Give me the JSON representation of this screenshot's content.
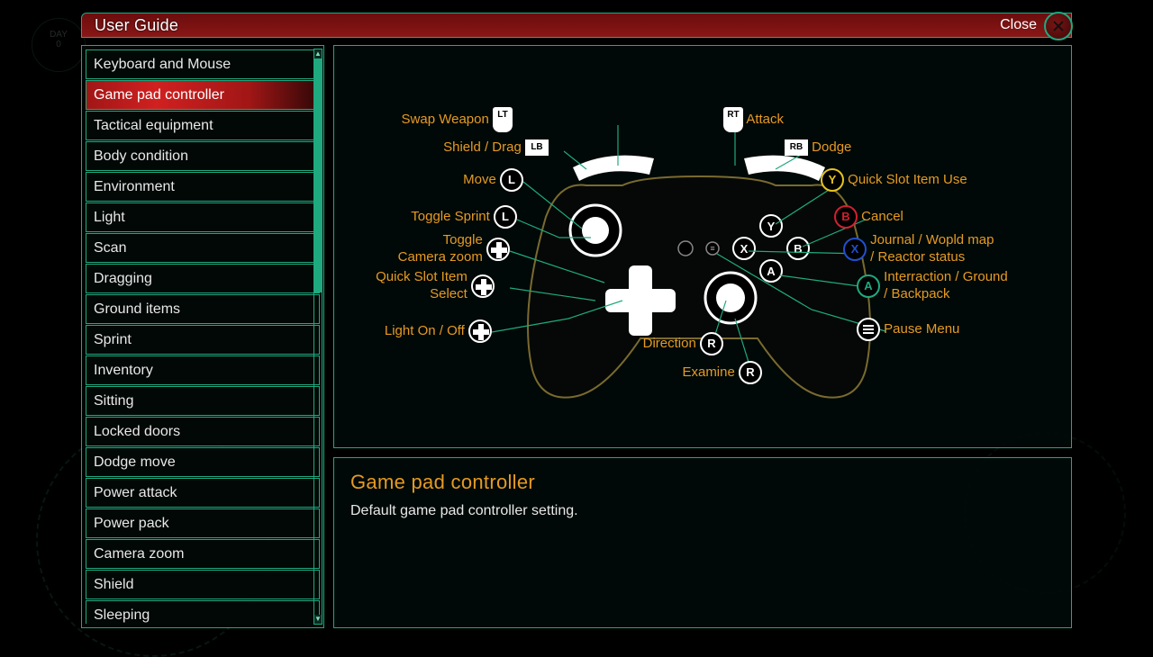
{
  "window": {
    "title": "User Guide",
    "close_label": "Close"
  },
  "bg": {
    "day_label": "DAY",
    "day_value": "0"
  },
  "sidebar": {
    "items": [
      "Keyboard and Mouse",
      "Game pad controller",
      "Tactical equipment",
      "Body condition",
      "Environment",
      "Light",
      "Scan",
      "Dragging",
      "Ground items",
      "Sprint",
      "Inventory",
      "Sitting",
      "Locked doors",
      "Dodge move",
      "Power attack",
      "Power pack",
      "Camera zoom",
      "Shield",
      "Sleeping"
    ],
    "selected_index": 1
  },
  "description": {
    "title": "Game pad controller",
    "text": "Default game pad controller setting."
  },
  "controller": {
    "left": {
      "swap_weapon": {
        "label": "Swap Weapon",
        "btn": "LT"
      },
      "shield_drag": {
        "label": "Shield / Drag",
        "btn": "LB"
      },
      "move": {
        "label": "Move",
        "btn": "L"
      },
      "toggle_sprint": {
        "label": "Toggle Sprint",
        "btn": "L"
      },
      "camera_zoom": {
        "label": "Toggle\nCamera zoom",
        "btn": ""
      },
      "quick_slot_sel": {
        "label": "Quick Slot Item\nSelect",
        "btn": ""
      },
      "light": {
        "label": "Light On / Off",
        "btn": ""
      }
    },
    "right": {
      "attack": {
        "label": "Attack",
        "btn": "RT"
      },
      "dodge": {
        "label": "Dodge",
        "btn": "RB"
      },
      "quick_use": {
        "label": "Quick Slot Item Use",
        "btn": "Y"
      },
      "cancel": {
        "label": "Cancel",
        "btn": "B"
      },
      "journal": {
        "label": "Journal / Wopld map\n/ Reactor status",
        "btn": "X"
      },
      "interact": {
        "label": "Interraction / Ground\n/ Backpack",
        "btn": "A"
      },
      "pause": {
        "label": "Pause Menu",
        "btn": "≡"
      }
    },
    "bottom": {
      "direction": {
        "label": "Direction",
        "btn": "R"
      },
      "examine": {
        "label": "Examine",
        "btn": "R"
      }
    }
  }
}
